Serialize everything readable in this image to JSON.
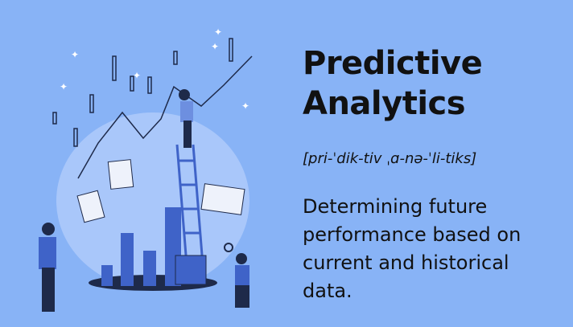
{
  "title_line1": "Predictive",
  "title_line2": "Analytics",
  "pronunciation": "[pri-ˈdik-tiv ˌɑ-nə-ˈli-tiks]",
  "description": "Determining future performance based on current and historical data.",
  "colors": {
    "background": "#88b3f6",
    "bars": "#3f63c8",
    "dark": "#1e2a4a"
  }
}
